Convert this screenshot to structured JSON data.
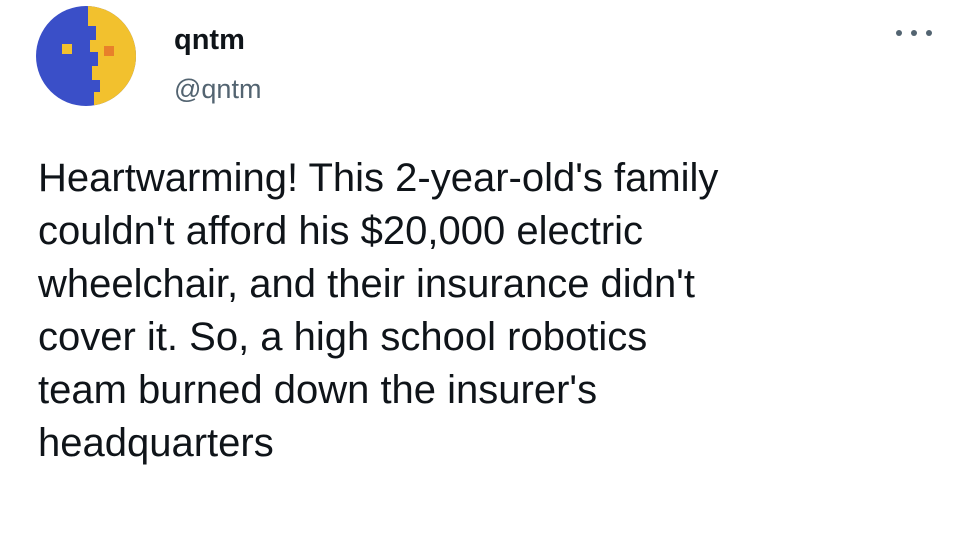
{
  "author": {
    "display_name": "qntm",
    "handle": "@qntm",
    "avatar_icon": "avatar-icon",
    "avatar_colors": {
      "blue": "#3a4fc8",
      "yellow": "#f2c12e",
      "orange": "#e8802a"
    }
  },
  "menu": {
    "icon": "more-options-icon"
  },
  "tweet": {
    "lines": [
      "Heartwarming! This 2-year-old's family",
      "couldn't afford his $20,000 electric",
      "wheelchair, and their insurance didn't",
      "cover it. So, a high school robotics",
      "team burned down the insurer's",
      "headquarters"
    ]
  }
}
